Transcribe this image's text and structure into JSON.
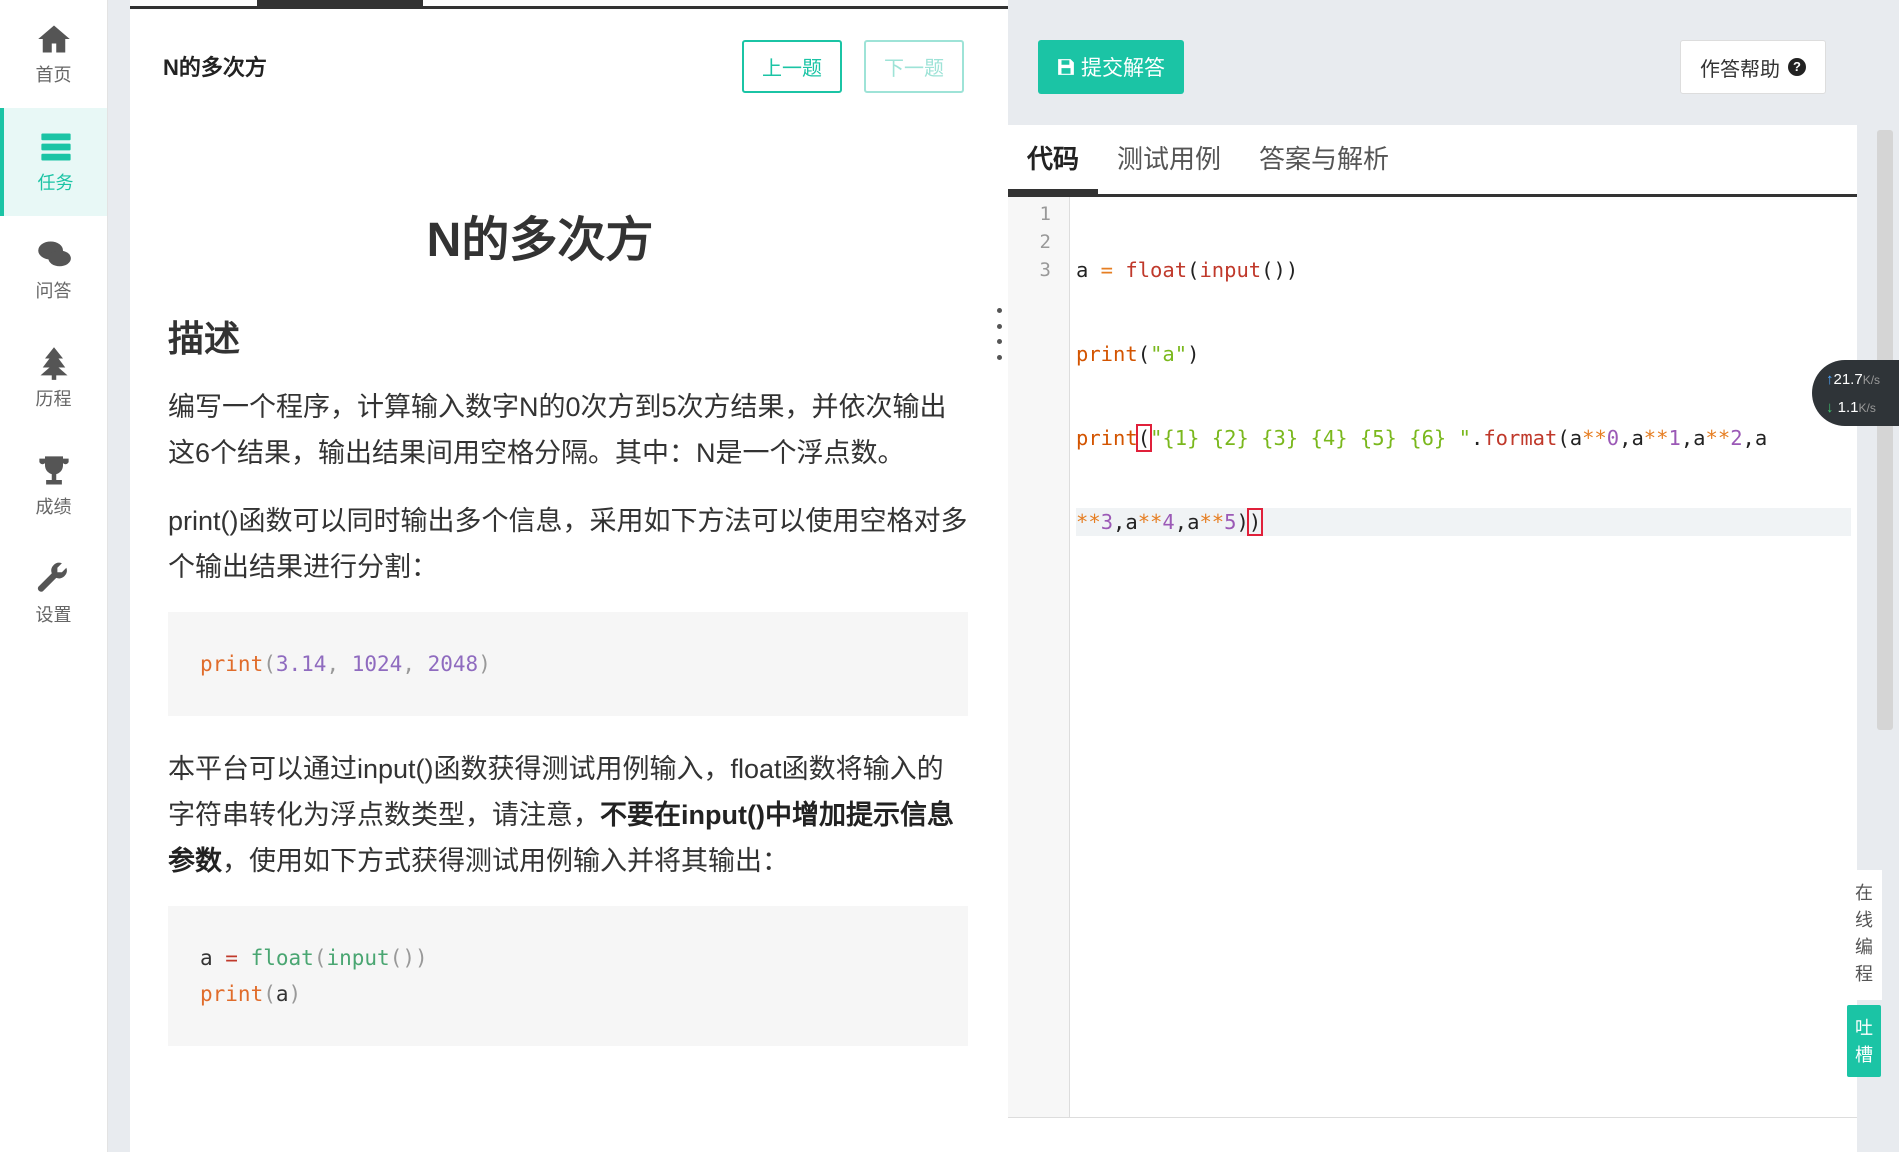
{
  "nav": {
    "items": [
      {
        "label": "首页",
        "icon": "home-icon"
      },
      {
        "label": "任务",
        "icon": "tasks-icon"
      },
      {
        "label": "问答",
        "icon": "chat-icon"
      },
      {
        "label": "历程",
        "icon": "tree-icon"
      },
      {
        "label": "成绩",
        "icon": "trophy-icon"
      },
      {
        "label": "设置",
        "icon": "wrench-icon"
      }
    ],
    "active_index": 1
  },
  "problem": {
    "header_title": "N的多次方",
    "prev_label": "上一题",
    "next_label": "下一题",
    "title": "N的多次方",
    "section_heading": "描述",
    "para1": "编写一个程序，计算输入数字N的0次方到5次方结果，并依次输出这6个结果，输出结果间用空格分隔。其中：N是一个浮点数。",
    "para2": "print()函数可以同时输出多个信息，采用如下方法可以使用空格对多个输出结果进行分割：",
    "code1": {
      "kw": "print",
      "open": "(",
      "n1": "3.14",
      "c1": ", ",
      "n2": "1024",
      "c2": ", ",
      "n3": "2048",
      "close": ")"
    },
    "para3_a": "本平台可以通过input()函数获得测试用例输入，float函数将输入的字符串转化为浮点数类型，请注意，",
    "para3_bold": "不要在input()中增加提示信息参数",
    "para3_b": "，使用如下方式获得测试用例输入并将其输出：",
    "code2": {
      "line1_var": "a",
      "line1_eq": " = ",
      "line1_fn1": "float",
      "line1_p1": "(",
      "line1_fn2": "input",
      "line1_p2": "())",
      "line2_kw": "print",
      "line2_p1": "(",
      "line2_arg": "a",
      "line2_p2": ")"
    }
  },
  "editor": {
    "submit_label": "提交解答",
    "help_label": "作答帮助",
    "tabs": [
      "代码",
      "测试用例",
      "答案与解析"
    ],
    "active_tab": 0,
    "line_numbers": [
      "1",
      "2",
      "3"
    ],
    "code": {
      "l1": {
        "var": "a",
        "eq": " = ",
        "fn1": "float",
        "p1": "(",
        "fn2": "input",
        "p2": "())"
      },
      "l2": {
        "kw": "print",
        "p1": "(",
        "str": "\"a\"",
        "p2": ")"
      },
      "l3": {
        "kw": "print",
        "p1": "(",
        "str": "\"{1} {2} {3} {4} {5} {6} \"",
        "dot": ".",
        "fn": "format",
        "p2": "(",
        "a0": "a",
        "op0": "**",
        "n0": "0",
        "cm0": ",",
        "a1": "a",
        "op1": "**",
        "n1": "1",
        "cm1": ",",
        "a2": "a",
        "op2": "**",
        "n2": "2",
        "cm2": ",",
        "a3": "a"
      },
      "l3b": {
        "op3": "**",
        "n3": "3",
        "cm3": ",",
        "a4": "a",
        "op4": "**",
        "n4": "4",
        "cm4": ",",
        "a5": "a",
        "op5": "**",
        "n5": "5",
        "p3": ")",
        "p4": ")"
      }
    }
  },
  "net_speed": {
    "up": "21.7",
    "down": "1.1",
    "unit": "K/s"
  },
  "side_tags": {
    "online": [
      "在",
      "线",
      "编",
      "程"
    ],
    "tucao": [
      "吐",
      "槽"
    ]
  },
  "colors": {
    "accent": "#1bc4a5"
  }
}
